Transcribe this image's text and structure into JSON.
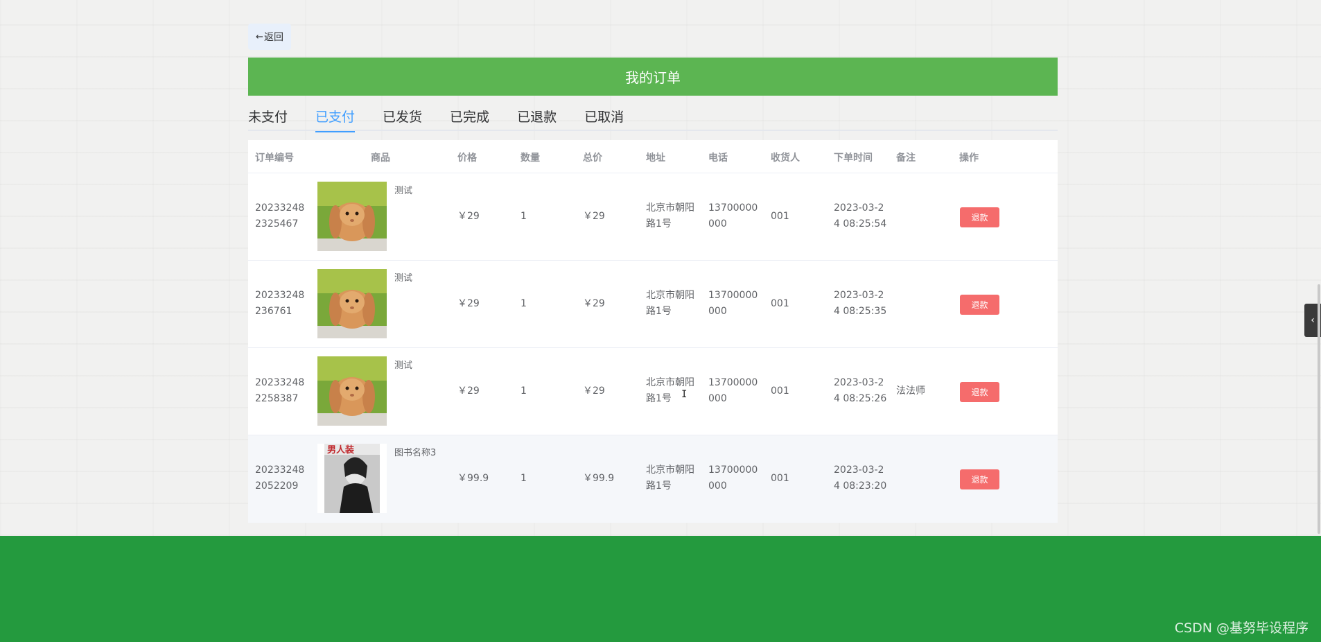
{
  "back_button": {
    "arrow": "←",
    "label": "返回"
  },
  "title": "我的订单",
  "tabs": [
    "未支付",
    "已支付",
    "已发货",
    "已完成",
    "已退款",
    "已取消"
  ],
  "active_tab": "已支付",
  "table": {
    "headers": [
      "订单编号",
      "商品",
      "价格",
      "数量",
      "总价",
      "地址",
      "电话",
      "收货人",
      "下单时间",
      "备注",
      "操作"
    ],
    "rows": [
      {
        "order_no_1": "20233248",
        "order_no_2": "2325467",
        "product_name": "测试",
        "product_image": "rabbit-photo",
        "price": "￥29",
        "quantity": "1",
        "total": "￥29",
        "address_1": "北京市朝阳",
        "address_2": "路1号",
        "phone_1": "13700000",
        "phone_2": "000",
        "receiver": "001",
        "time_1": "2023-03-2",
        "time_2": "4 08:25:54",
        "note": "",
        "action": "退款"
      },
      {
        "order_no_1": "20233248",
        "order_no_2": "236761",
        "product_name": "测试",
        "product_image": "rabbit-photo",
        "price": "￥29",
        "quantity": "1",
        "total": "￥29",
        "address_1": "北京市朝阳",
        "address_2": "路1号",
        "phone_1": "13700000",
        "phone_2": "000",
        "receiver": "001",
        "time_1": "2023-03-2",
        "time_2": "4 08:25:35",
        "note": "",
        "action": "退款"
      },
      {
        "order_no_1": "20233248",
        "order_no_2": "2258387",
        "product_name": "测试",
        "product_image": "rabbit-photo",
        "price": "￥29",
        "quantity": "1",
        "total": "￥29",
        "address_1": "北京市朝阳",
        "address_2": "路1号",
        "phone_1": "13700000",
        "phone_2": "000",
        "receiver": "001",
        "time_1": "2023-03-2",
        "time_2": "4 08:25:26",
        "note": "法法师",
        "action": "退款"
      },
      {
        "order_no_1": "20233248",
        "order_no_2": "2052209",
        "product_name": "图书名称3",
        "product_image": "book-cover",
        "price": "￥99.9",
        "quantity": "1",
        "total": "￥99.9",
        "address_1": "北京市朝阳",
        "address_2": "路1号",
        "phone_1": "13700000",
        "phone_2": "000",
        "receiver": "001",
        "time_1": "2023-03-2",
        "time_2": "4 08:23:20",
        "note": "",
        "action": "退款"
      }
    ]
  },
  "watermark": "CSDN @基努毕设程序",
  "side_toggle_icon": "‹",
  "colors": {
    "title_bar": "#5cb552",
    "footer": "#249a3e",
    "active_tab": "#409eff",
    "refund_button": "#f56c6c"
  }
}
